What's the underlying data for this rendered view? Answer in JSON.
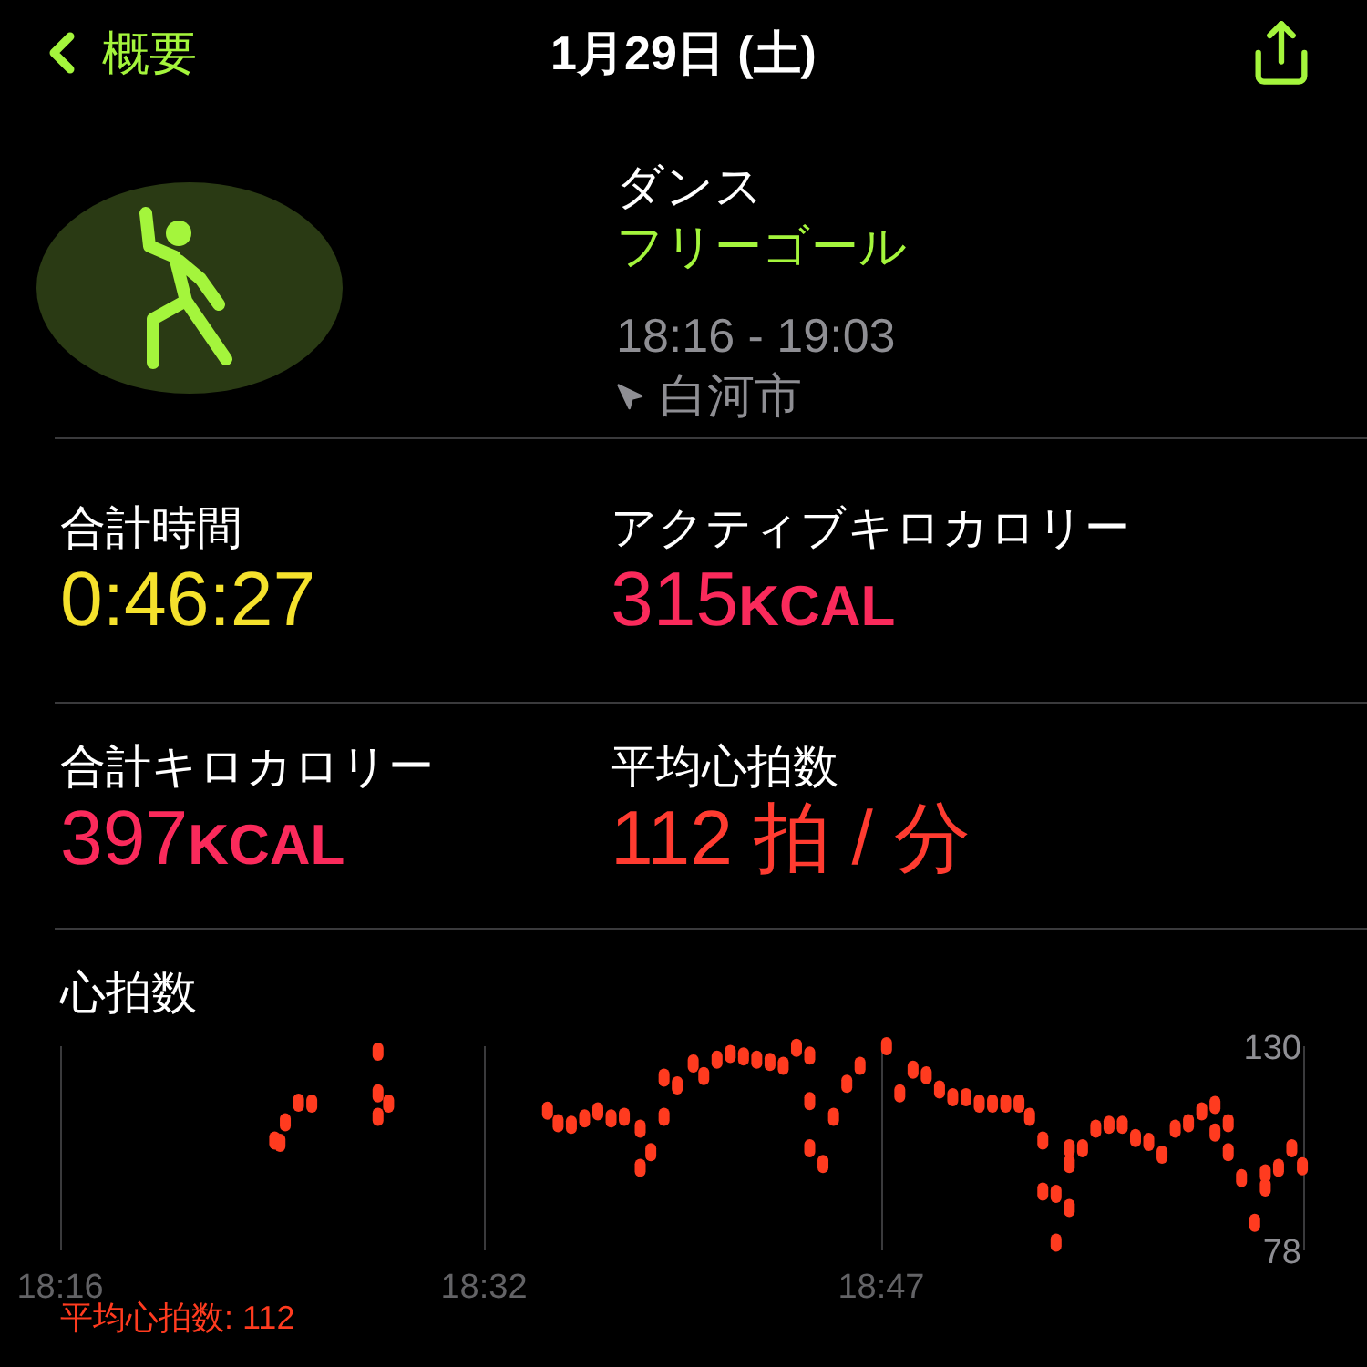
{
  "nav": {
    "back": "概要",
    "title": "1月29日 (土)"
  },
  "workout": {
    "type": "ダンス",
    "goal": "フリーゴール",
    "time": "18:16 - 19:03",
    "location": "白河市"
  },
  "metrics": [
    {
      "label": "合計時間",
      "value": "0:46:27",
      "color": "#f5e12c"
    },
    {
      "label": "アクティブキロカロリー",
      "value": "315",
      "unit": "KCAL",
      "color": "#fa2a5b"
    },
    {
      "label": "合計キロカロリー",
      "value": "397",
      "unit": "KCAL",
      "color": "#fa2a5b"
    },
    {
      "label": "平均心拍数",
      "value": "112 拍 / 分",
      "color": "#ff3b30"
    }
  ],
  "heart_rate": {
    "average": "平均心拍数: 112",
    "chart_data": {
      "type": "scatter",
      "title": "心拍数",
      "xlim": [
        1096,
        1143
      ],
      "ylim": [
        78,
        130
      ],
      "yticks": [
        130,
        78
      ],
      "xticks": [
        {
          "value": 1096,
          "label": "18:16"
        },
        {
          "value": 1112,
          "label": "18:32"
        },
        {
          "value": 1127,
          "label": "18:47"
        }
      ],
      "x": [
        1104.1,
        1104.3,
        1104.5,
        1105,
        1105.5,
        1108,
        1108,
        1108,
        1108.4,
        1114.4,
        1114.8,
        1115.3,
        1115.8,
        1116.3,
        1116.8,
        1117.3,
        1117.9,
        1117.9,
        1118.3,
        1118.8,
        1118.8,
        1119.3,
        1119.9,
        1120.3,
        1120.8,
        1121.3,
        1121.8,
        1122.3,
        1122.8,
        1123.3,
        1123.8,
        1124.3,
        1124.3,
        1124.3,
        1124.8,
        1125.2,
        1125.7,
        1126.2,
        1127.2,
        1127.7,
        1128.2,
        1128.7,
        1129.2,
        1129.7,
        1130.2,
        1130.7,
        1131.2,
        1131.7,
        1132.2,
        1132.6,
        1133.1,
        1133.1,
        1133.6,
        1133.6,
        1134.1,
        1134.1,
        1134.1,
        1134.6,
        1135.1,
        1135.6,
        1136.1,
        1136.6,
        1137.1,
        1137.6,
        1138.1,
        1138.6,
        1139.1,
        1139.6,
        1139.6,
        1140.1,
        1140.1,
        1140.6,
        1141.1,
        1141.5,
        1141.5,
        1142,
        1142.5,
        1142.9
      ],
      "series": [
        {
          "color": "#ff3b1f",
          "values": [
            106,
            105.4,
            110.6,
            115.6,
            115.4,
            128.6,
            118,
            112,
            115.4,
            113.6,
            110.4,
            110,
            111.6,
            113.4,
            111.6,
            112,
            99,
            109,
            103,
            112,
            122,
            120,
            125.6,
            122.4,
            126.6,
            128,
            127.4,
            126.6,
            126,
            125,
            129.6,
            127.6,
            116,
            104,
            100,
            112,
            120.4,
            125,
            130,
            118,
            124,
            122.6,
            119,
            117,
            117,
            115.4,
            115.4,
            115.4,
            115.4,
            112,
            106,
            93,
            92.4,
            80,
            88.8,
            100,
            104,
            104,
            109,
            110,
            110,
            106.6,
            105.6,
            102.4,
            109,
            110.4,
            113.4,
            115,
            108,
            110.4,
            103,
            96.4,
            85,
            94,
            97.6,
            99,
            104,
            99.4
          ]
        }
      ]
    }
  }
}
